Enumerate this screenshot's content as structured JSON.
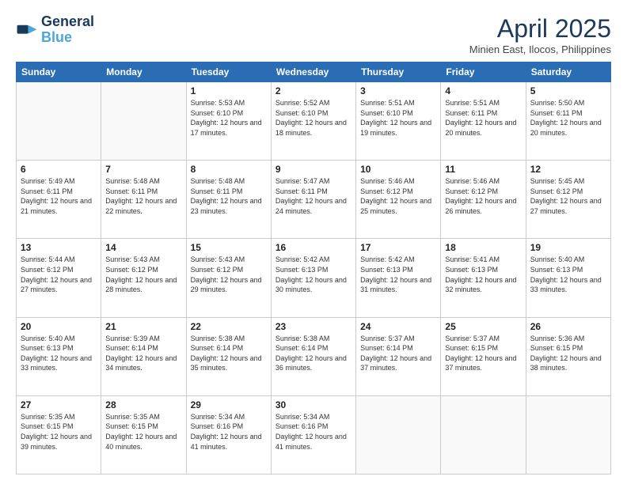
{
  "logo": {
    "line1": "General",
    "line2": "Blue"
  },
  "title": "April 2025",
  "subtitle": "Minien East, Ilocos, Philippines",
  "days_of_week": [
    "Sunday",
    "Monday",
    "Tuesday",
    "Wednesday",
    "Thursday",
    "Friday",
    "Saturday"
  ],
  "weeks": [
    [
      {
        "day": "",
        "info": ""
      },
      {
        "day": "",
        "info": ""
      },
      {
        "day": "1",
        "info": "Sunrise: 5:53 AM\nSunset: 6:10 PM\nDaylight: 12 hours and 17 minutes."
      },
      {
        "day": "2",
        "info": "Sunrise: 5:52 AM\nSunset: 6:10 PM\nDaylight: 12 hours and 18 minutes."
      },
      {
        "day": "3",
        "info": "Sunrise: 5:51 AM\nSunset: 6:10 PM\nDaylight: 12 hours and 19 minutes."
      },
      {
        "day": "4",
        "info": "Sunrise: 5:51 AM\nSunset: 6:11 PM\nDaylight: 12 hours and 20 minutes."
      },
      {
        "day": "5",
        "info": "Sunrise: 5:50 AM\nSunset: 6:11 PM\nDaylight: 12 hours and 20 minutes."
      }
    ],
    [
      {
        "day": "6",
        "info": "Sunrise: 5:49 AM\nSunset: 6:11 PM\nDaylight: 12 hours and 21 minutes."
      },
      {
        "day": "7",
        "info": "Sunrise: 5:48 AM\nSunset: 6:11 PM\nDaylight: 12 hours and 22 minutes."
      },
      {
        "day": "8",
        "info": "Sunrise: 5:48 AM\nSunset: 6:11 PM\nDaylight: 12 hours and 23 minutes."
      },
      {
        "day": "9",
        "info": "Sunrise: 5:47 AM\nSunset: 6:11 PM\nDaylight: 12 hours and 24 minutes."
      },
      {
        "day": "10",
        "info": "Sunrise: 5:46 AM\nSunset: 6:12 PM\nDaylight: 12 hours and 25 minutes."
      },
      {
        "day": "11",
        "info": "Sunrise: 5:46 AM\nSunset: 6:12 PM\nDaylight: 12 hours and 26 minutes."
      },
      {
        "day": "12",
        "info": "Sunrise: 5:45 AM\nSunset: 6:12 PM\nDaylight: 12 hours and 27 minutes."
      }
    ],
    [
      {
        "day": "13",
        "info": "Sunrise: 5:44 AM\nSunset: 6:12 PM\nDaylight: 12 hours and 27 minutes."
      },
      {
        "day": "14",
        "info": "Sunrise: 5:43 AM\nSunset: 6:12 PM\nDaylight: 12 hours and 28 minutes."
      },
      {
        "day": "15",
        "info": "Sunrise: 5:43 AM\nSunset: 6:12 PM\nDaylight: 12 hours and 29 minutes."
      },
      {
        "day": "16",
        "info": "Sunrise: 5:42 AM\nSunset: 6:13 PM\nDaylight: 12 hours and 30 minutes."
      },
      {
        "day": "17",
        "info": "Sunrise: 5:42 AM\nSunset: 6:13 PM\nDaylight: 12 hours and 31 minutes."
      },
      {
        "day": "18",
        "info": "Sunrise: 5:41 AM\nSunset: 6:13 PM\nDaylight: 12 hours and 32 minutes."
      },
      {
        "day": "19",
        "info": "Sunrise: 5:40 AM\nSunset: 6:13 PM\nDaylight: 12 hours and 33 minutes."
      }
    ],
    [
      {
        "day": "20",
        "info": "Sunrise: 5:40 AM\nSunset: 6:13 PM\nDaylight: 12 hours and 33 minutes."
      },
      {
        "day": "21",
        "info": "Sunrise: 5:39 AM\nSunset: 6:14 PM\nDaylight: 12 hours and 34 minutes."
      },
      {
        "day": "22",
        "info": "Sunrise: 5:38 AM\nSunset: 6:14 PM\nDaylight: 12 hours and 35 minutes."
      },
      {
        "day": "23",
        "info": "Sunrise: 5:38 AM\nSunset: 6:14 PM\nDaylight: 12 hours and 36 minutes."
      },
      {
        "day": "24",
        "info": "Sunrise: 5:37 AM\nSunset: 6:14 PM\nDaylight: 12 hours and 37 minutes."
      },
      {
        "day": "25",
        "info": "Sunrise: 5:37 AM\nSunset: 6:15 PM\nDaylight: 12 hours and 37 minutes."
      },
      {
        "day": "26",
        "info": "Sunrise: 5:36 AM\nSunset: 6:15 PM\nDaylight: 12 hours and 38 minutes."
      }
    ],
    [
      {
        "day": "27",
        "info": "Sunrise: 5:35 AM\nSunset: 6:15 PM\nDaylight: 12 hours and 39 minutes."
      },
      {
        "day": "28",
        "info": "Sunrise: 5:35 AM\nSunset: 6:15 PM\nDaylight: 12 hours and 40 minutes."
      },
      {
        "day": "29",
        "info": "Sunrise: 5:34 AM\nSunset: 6:16 PM\nDaylight: 12 hours and 41 minutes."
      },
      {
        "day": "30",
        "info": "Sunrise: 5:34 AM\nSunset: 6:16 PM\nDaylight: 12 hours and 41 minutes."
      },
      {
        "day": "",
        "info": ""
      },
      {
        "day": "",
        "info": ""
      },
      {
        "day": "",
        "info": ""
      }
    ]
  ]
}
